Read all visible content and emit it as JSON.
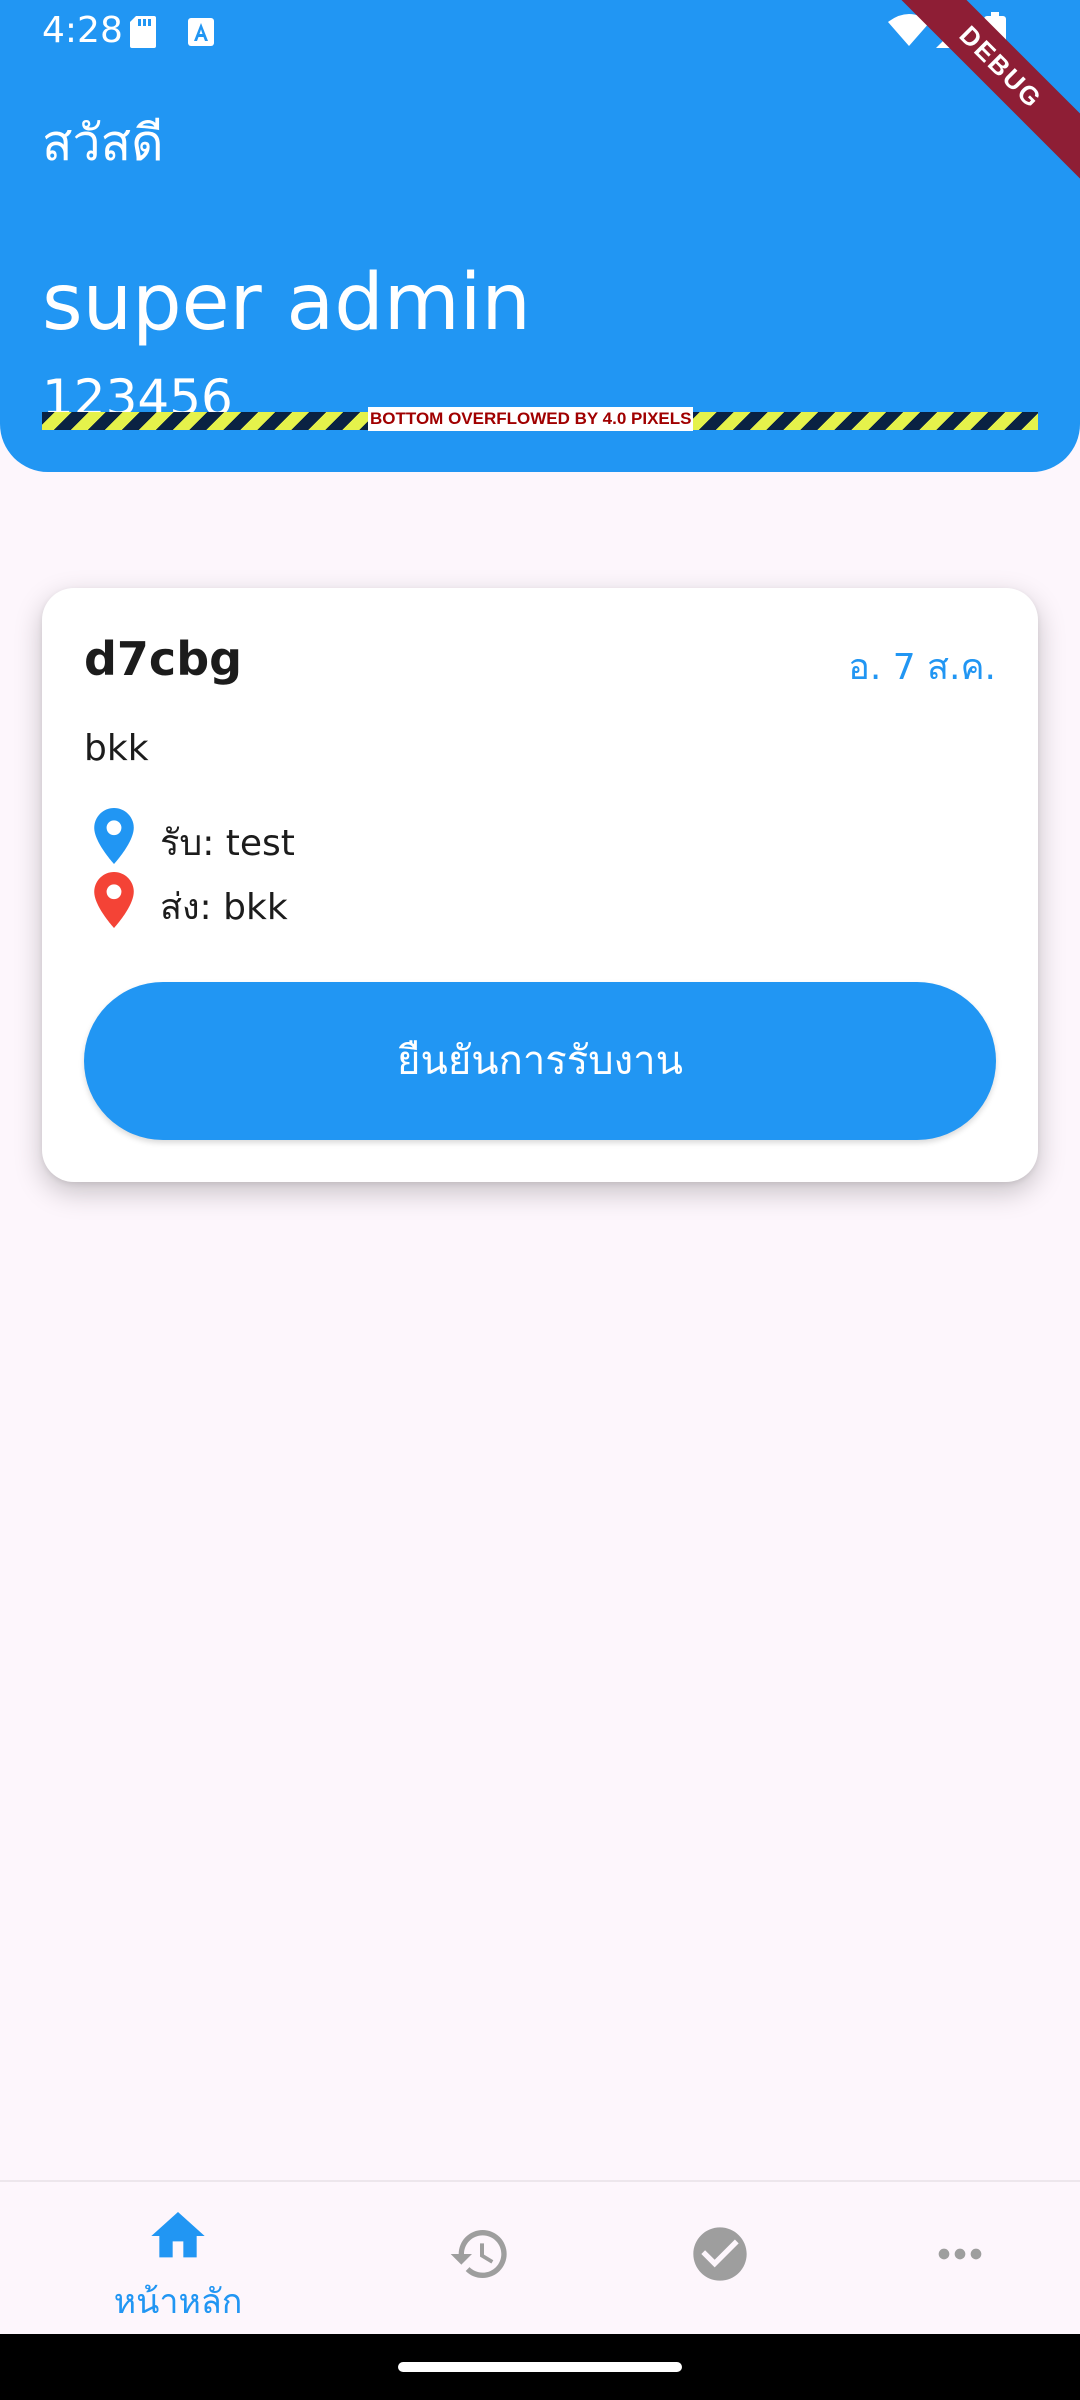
{
  "status_bar": {
    "time": "4:28",
    "icons": [
      "sd-card-icon",
      "a-icon",
      "wifi-icon",
      "signal-icon",
      "battery-icon"
    ]
  },
  "debug_banner": "DEBUG",
  "header": {
    "greeting": "สวัสดี",
    "user_name": "super admin",
    "user_id": "123456",
    "overflow_warning": "BOTTOM OVERFLOWED BY 4.0 PIXELS"
  },
  "job_card": {
    "code": "d7cbg",
    "date": "อ. 7 ส.ค.",
    "description": "bkk",
    "pickup": "รับ: test",
    "dropoff": "ส่ง: bkk",
    "confirm_label": "ยืนยันการรับงาน"
  },
  "bottom_nav": {
    "items": [
      {
        "icon": "home-icon",
        "label": "หน้าหลัก",
        "active": true
      },
      {
        "icon": "history-icon",
        "label": "",
        "active": false
      },
      {
        "icon": "check-circle-icon",
        "label": "",
        "active": false
      },
      {
        "icon": "more-horiz-icon",
        "label": "",
        "active": false
      }
    ]
  },
  "colors": {
    "primary": "#2196F3",
    "background": "#FDF6FC",
    "pickup_pin": "#2196F3",
    "dropoff_pin": "#F44336",
    "inactive_icon": "#9E9E9E",
    "debug_banner": "#8E1E35"
  }
}
